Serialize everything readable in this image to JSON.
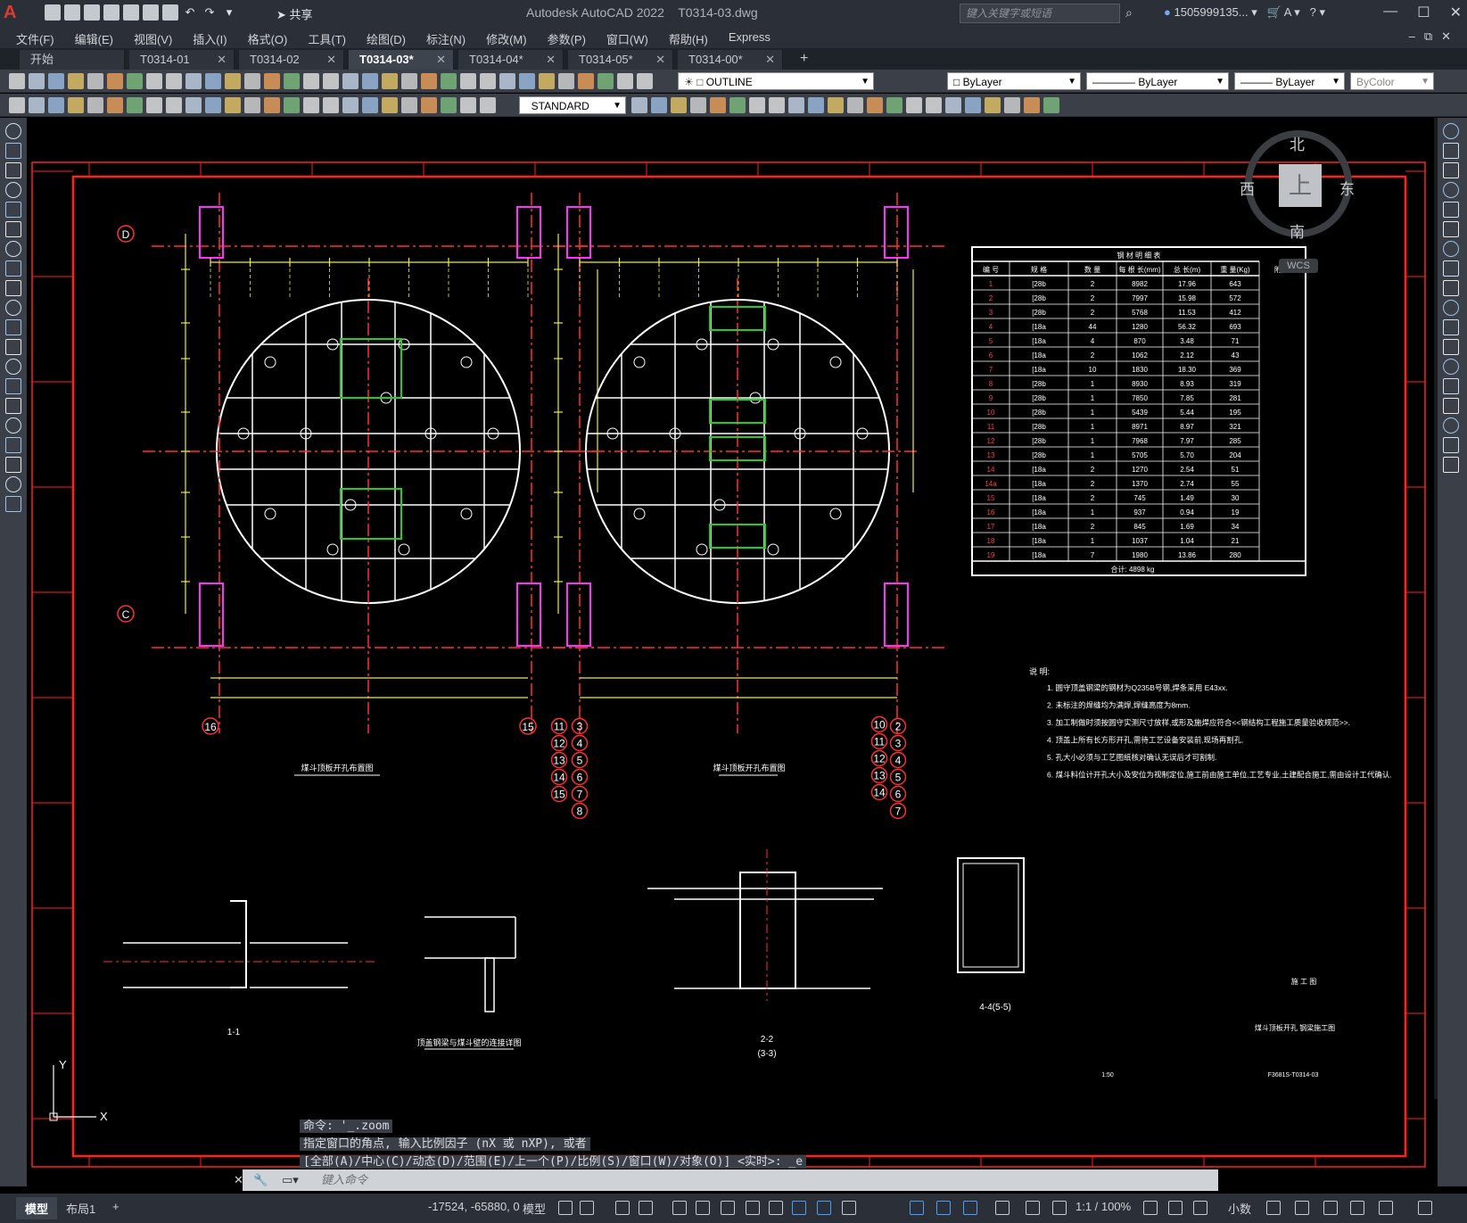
{
  "app": {
    "logo": "A",
    "title": "Autodesk AutoCAD 2022",
    "file": "T0314-03.dwg",
    "share": "共享",
    "search_placeholder": "键入关键字或短语",
    "user": "1505999135...",
    "window_controls": [
      "minimize-icon",
      "restore-icon",
      "close-icon"
    ]
  },
  "menu": [
    "文件(F)",
    "编辑(E)",
    "视图(V)",
    "插入(I)",
    "格式(O)",
    "工具(T)",
    "绘图(D)",
    "标注(N)",
    "修改(M)",
    "参数(P)",
    "窗口(W)",
    "帮助(H)",
    "Express"
  ],
  "tabs": [
    {
      "label": "开始",
      "active": false
    },
    {
      "label": "T0314-01",
      "active": false
    },
    {
      "label": "T0314-02",
      "active": false
    },
    {
      "label": "T0314-03*",
      "active": true
    },
    {
      "label": "T0314-04*",
      "active": false
    },
    {
      "label": "T0314-05*",
      "active": false
    },
    {
      "label": "T0314-00*",
      "active": false
    }
  ],
  "toolbar": {
    "layer": "OUTLINE",
    "color": "ByLayer",
    "linetype": "ByLayer",
    "lineweight": "ByLayer",
    "plotstyle": "ByColor",
    "textstyle": "STANDARD"
  },
  "viewcube": {
    "north": "北",
    "south": "南",
    "east": "东",
    "west": "西",
    "face": "上",
    "wcs": "WCS"
  },
  "drawing": {
    "plan_left_title": "煤斗顶板开孔布置图",
    "plan_right_title": "煤斗顶板开孔布置图",
    "axis_labels": {
      "d": "D",
      "c": "C",
      "a16": "16",
      "a15": "15"
    },
    "table_title": "钢 材 明 细 表",
    "table_headers": [
      "编 号",
      "规 格",
      "数 量",
      "每 根 长(mm)",
      "总 长(m)",
      "重 量(Kg)",
      "附 注"
    ],
    "table_rows": [
      [
        "1",
        "[28b",
        "2",
        "8982",
        "17.96",
        "643"
      ],
      [
        "2",
        "[28b",
        "2",
        "7997",
        "15.98",
        "572"
      ],
      [
        "3",
        "[28b",
        "2",
        "5768",
        "11.53",
        "412"
      ],
      [
        "4",
        "[18a",
        "44",
        "1280",
        "56.32",
        "693"
      ],
      [
        "5",
        "[18a",
        "4",
        "870",
        "3.48",
        "71"
      ],
      [
        "6",
        "[18a",
        "2",
        "1062",
        "2.12",
        "43"
      ],
      [
        "7",
        "[18a",
        "10",
        "1830",
        "18.30",
        "369"
      ],
      [
        "8",
        "[28b",
        "1",
        "8930",
        "8.93",
        "319"
      ],
      [
        "9",
        "[28b",
        "1",
        "7850",
        "7.85",
        "281"
      ],
      [
        "10",
        "[28b",
        "1",
        "5439",
        "5.44",
        "195"
      ],
      [
        "11",
        "[28b",
        "1",
        "8971",
        "8.97",
        "321"
      ],
      [
        "12",
        "[28b",
        "1",
        "7968",
        "7.97",
        "285"
      ],
      [
        "13",
        "[28b",
        "1",
        "5705",
        "5.70",
        "204"
      ],
      [
        "14",
        "[18a",
        "2",
        "1270",
        "2.54",
        "51"
      ],
      [
        "14a",
        "[18a",
        "2",
        "1370",
        "2.74",
        "55"
      ],
      [
        "15",
        "[18a",
        "2",
        "745",
        "1.49",
        "30"
      ],
      [
        "16",
        "[18a",
        "1",
        "937",
        "0.94",
        "19"
      ],
      [
        "17",
        "[18a",
        "2",
        "845",
        "1.69",
        "34"
      ],
      [
        "18",
        "[18a",
        "1",
        "1037",
        "1.04",
        "21"
      ],
      [
        "19",
        "[18a",
        "7",
        "1980",
        "13.86",
        "280"
      ]
    ],
    "table_total": "合计: 4898 kg",
    "notes_title": "说 明:",
    "notes": [
      "1. 圆守顶盖钢梁的钢材为Q235B号钢,焊条采用 E43xx.",
      "2. 未标注的焊缝均为满焊,焊缝高度为8mm.",
      "3. 加工制做时须按圆守实测尺寸放样,或形及施焊应符合<<钢结构工程施工质量验收规范>>.",
      "4. 顶盖上所有长方形开孔,需待工艺设备安装前,现场再割孔.",
      "5. 孔大小必须与工艺图纸核对确认无误后才可割制.",
      "6. 煤斗料位计开孔大小及安位为视制定位,施工前由施工单位,工艺专业,土建配合施工,需由设计工代确认."
    ],
    "section_11": "1-1",
    "section_connect": "顶盖钢梁与煤斗壁的连接详图",
    "section_22": "2-2",
    "section_33": "(3-3)",
    "section_44": "4-4(5-5)",
    "title_block_name": "煤斗顶板开孔 钢梁施工图",
    "title_block_stage": "施 工 图",
    "title_block_scale": "1:50",
    "title_block_no": "F3681S-T0314-03"
  },
  "command": {
    "line1": "命令: '_.zoom",
    "line2": "指定窗口的角点, 输入比例因子 (nX 或 nXP), 或者",
    "line3": "[全部(A)/中心(C)/动态(D)/范围(E)/上一个(P)/比例(S)/窗口(W)/对象(O)] <实时>: _e",
    "placeholder": "键入命令"
  },
  "status": {
    "model_tab": "模型",
    "layout_tab": "布局1",
    "coords": "-17524, -65880, 0",
    "space": "模型",
    "scale": "1:1 / 100%",
    "units": "小数"
  }
}
